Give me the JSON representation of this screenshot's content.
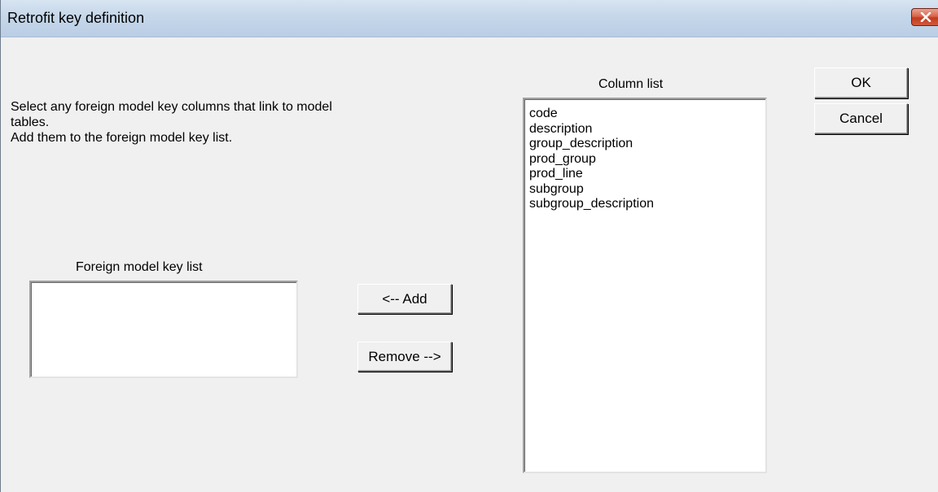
{
  "window": {
    "title": "Retrofit key definition",
    "close_icon": "close-x-icon"
  },
  "instructions": {
    "line1": "Select any foreign model key columns that link to model",
    "line2": "tables.",
    "line3": "Add them to the foreign model key list."
  },
  "foreign_key_list": {
    "label": "Foreign model key list",
    "items": []
  },
  "column_list": {
    "label": "Column list",
    "items": [
      "code",
      "description",
      "group_description",
      "prod_group",
      "prod_line",
      "subgroup",
      "subgroup_description"
    ]
  },
  "buttons": {
    "add": "<-- Add",
    "remove": "Remove -->",
    "ok": "OK",
    "cancel": "Cancel"
  }
}
